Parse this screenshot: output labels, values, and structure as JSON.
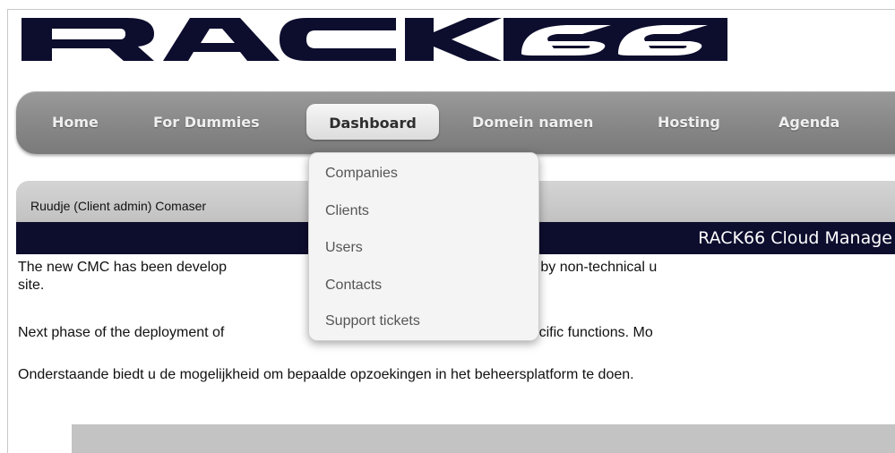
{
  "logo": {
    "text": "RACK66",
    "color": "#0d0d2e"
  },
  "nav": {
    "items": [
      {
        "label": "Home"
      },
      {
        "label": "For Dummies"
      },
      {
        "label": "Dashboard",
        "active": true
      },
      {
        "label": "Domein namen"
      },
      {
        "label": "Hosting"
      },
      {
        "label": "Agenda"
      }
    ]
  },
  "dropdown": {
    "items": [
      {
        "label": "Companies"
      },
      {
        "label": "Clients"
      },
      {
        "label": "Users"
      },
      {
        "label": "Contacts"
      },
      {
        "label": "Support tickets"
      }
    ]
  },
  "user": {
    "label": "Ruudje (Client admin) Comaser"
  },
  "title": {
    "text": "RACK66 Cloud Manage"
  },
  "content": {
    "p1_line1": "The new CMC has been develop                                           technicians as well as by non-technical u",
    "p1_line2": "site.",
    "p2": "Next phase of the deployment of                                          ist in elaboration of specific functions. Mo",
    "p3": "Onderstaande biedt u de mogelijkheid om bepaalde opzoekingen in het beheersplatform te doen."
  },
  "colors": {
    "navbar": "#8a8a8a",
    "titlebar": "#0d0d2e",
    "userbar": "#c8c8c8"
  }
}
